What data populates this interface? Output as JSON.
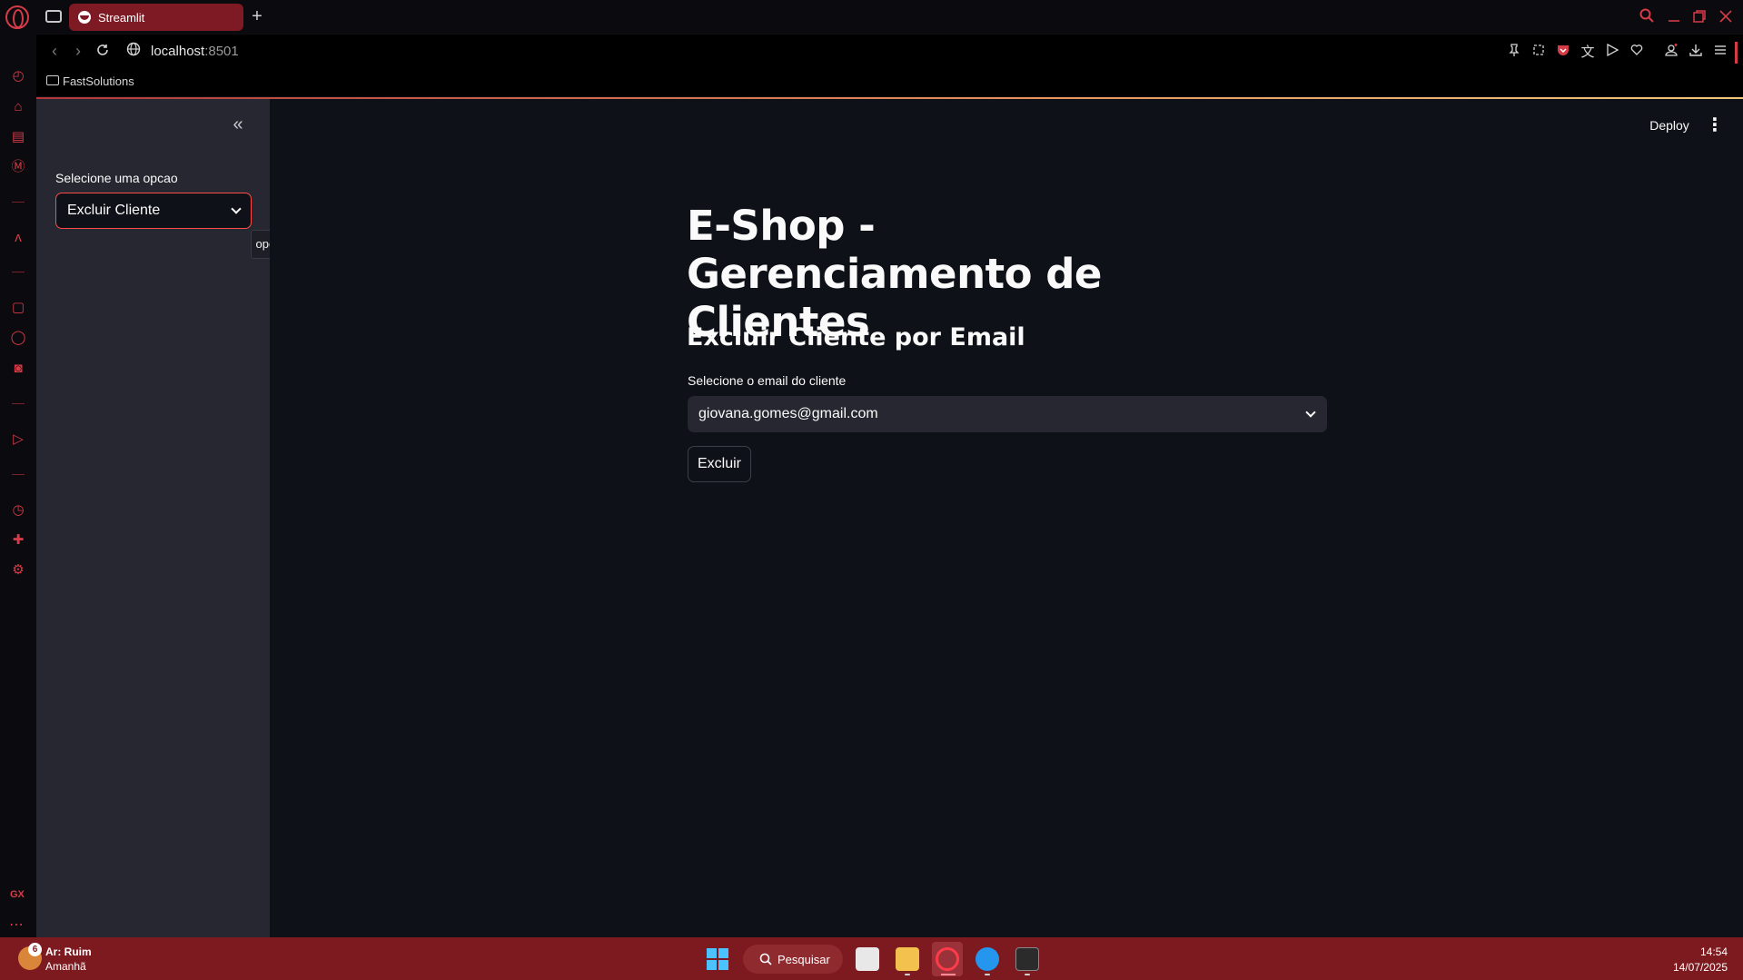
{
  "browser": {
    "tab_title": "Streamlit",
    "new_tab_symbol": "+",
    "url_host": "localhost",
    "url_port": ":8501",
    "bookmark_folder": "FastSolutions",
    "accent_color": "#d63b48"
  },
  "sidebar": {
    "select_label": "Selecione uma opcao",
    "select_value": "Excluir Cliente",
    "tooltip": "open"
  },
  "header": {
    "deploy_label": "Deploy"
  },
  "main": {
    "title": "E-Shop - Gerenciamento de Clientes",
    "subheader": "Excluir Cliente por Email",
    "email_label": "Selecione o email do cliente",
    "email_value": "giovana.gomes@gmail.com",
    "delete_button": "Excluir"
  },
  "taskbar": {
    "weather_badge": "6",
    "weather_line1": "Ar: Ruim",
    "weather_line2": "Amanhã",
    "search_label": "Pesquisar",
    "time": "14:54",
    "date": "14/07/2025"
  }
}
